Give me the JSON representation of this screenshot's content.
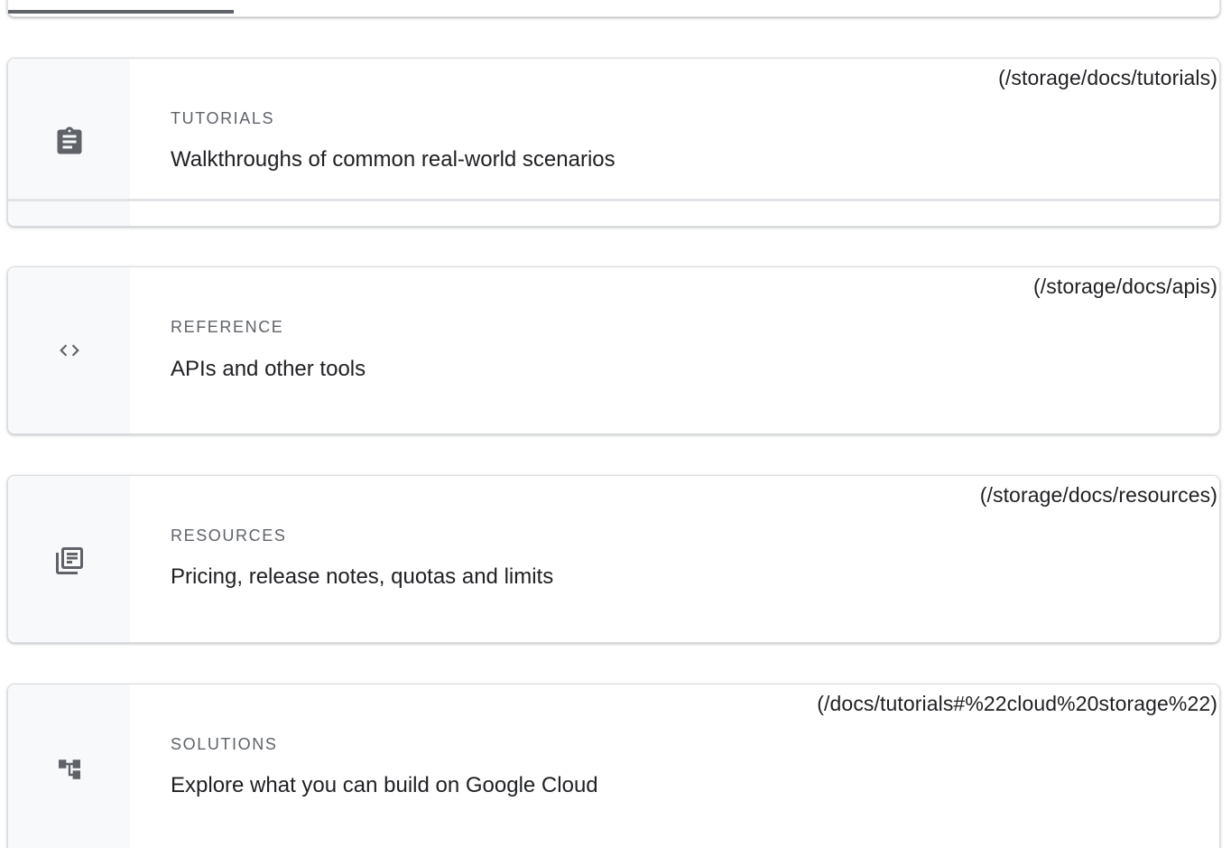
{
  "cards": [
    {
      "href": "(/storage/docs/tutorials)",
      "eyebrow": "TUTORIALS",
      "description": "Walkthroughs of common real-world scenarios",
      "icon": "clipboard-icon"
    },
    {
      "href": "(/storage/docs/apis)",
      "eyebrow": "REFERENCE",
      "description": "APIs and other tools",
      "icon": "code-icon"
    },
    {
      "href": "(/storage/docs/resources)",
      "eyebrow": "RESOURCES",
      "description": "Pricing, release notes, quotas and limits",
      "icon": "library-books-icon"
    },
    {
      "href": "(/docs/tutorials#%22cloud%20storage%22)",
      "eyebrow": "SOLUTIONS",
      "description": "Explore what you can build on Google Cloud",
      "icon": "account-tree-icon"
    }
  ],
  "colors": {
    "icon": "#5f6368",
    "eyebrow": "#5f6368",
    "text": "#202124",
    "side_panel": "#f8f9fa",
    "border": "#dadce0"
  }
}
